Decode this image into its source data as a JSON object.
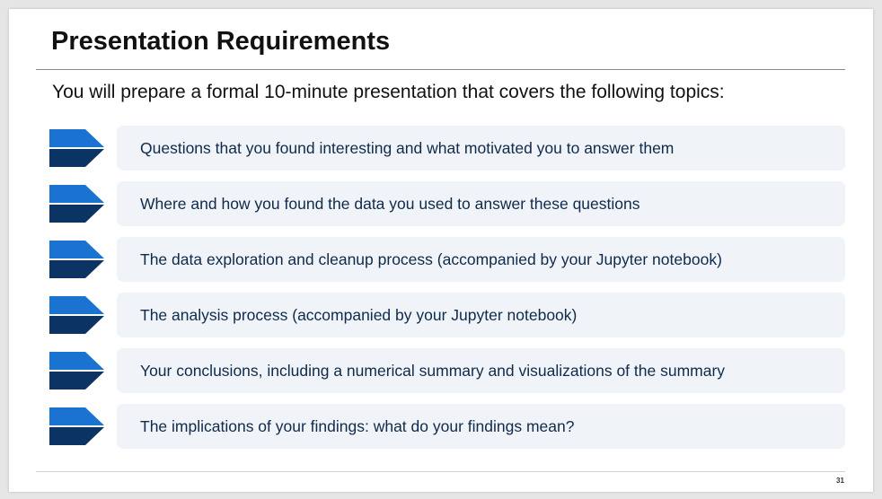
{
  "title": "Presentation Requirements",
  "subtitle": "You will prepare a formal 10-minute presentation that covers the following topics:",
  "colors": {
    "chevron_top": "#1a73d1",
    "chevron_bottom": "#0b3464",
    "box": "#f0f4f9",
    "text": "#0f2a4a"
  },
  "items": [
    {
      "icon": "chevron-arrow-icon",
      "text": "Questions that you found interesting and what motivated you to answer them"
    },
    {
      "icon": "chevron-arrow-icon",
      "text": "Where and how you found the data you used to answer these questions"
    },
    {
      "icon": "chevron-arrow-icon",
      "text": "The data exploration and cleanup process (accompanied by your Jupyter notebook)"
    },
    {
      "icon": "chevron-arrow-icon",
      "text": "The analysis process (accompanied by your Jupyter notebook)"
    },
    {
      "icon": "chevron-arrow-icon",
      "text": "Your conclusions, including a numerical summary and visualizations of the summary"
    },
    {
      "icon": "chevron-arrow-icon",
      "text": "The implications of your findings: what do your findings mean?"
    }
  ],
  "page_number": "31"
}
